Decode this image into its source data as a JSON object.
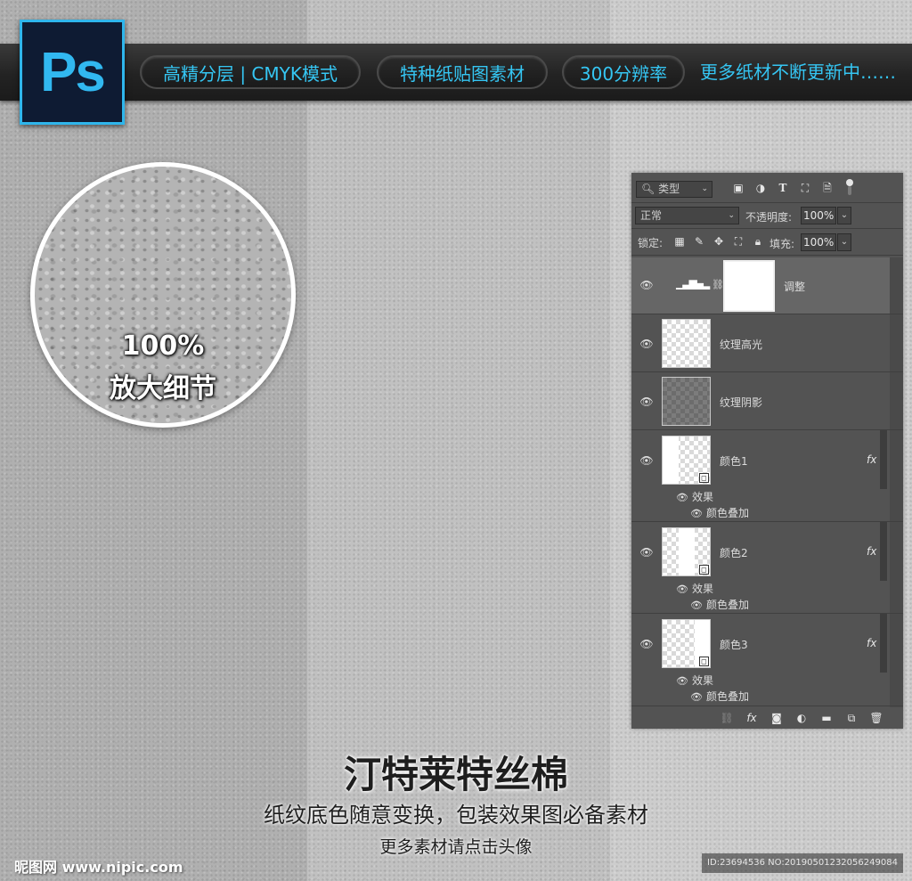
{
  "banner": {
    "logo_text": "Ps",
    "pills": [
      "高精分层 | CMYK模式",
      "特种纸贴图素材",
      "300分辨率"
    ],
    "more_text": "更多纸材不断更新中……"
  },
  "magnifier": {
    "percent": "100%",
    "label": "放大细节"
  },
  "layers_panel": {
    "filter": {
      "kind_label": "类型",
      "icons": [
        "image-filter-icon",
        "adjustment-filter-icon",
        "type-filter-icon",
        "shape-filter-icon",
        "smart-object-filter-icon"
      ]
    },
    "blend_mode": "正常",
    "opacity_label": "不透明度:",
    "opacity_value": "100%",
    "lock_label": "锁定:",
    "fill_label": "填充:",
    "fill_value": "100%",
    "layers": [
      {
        "name": "调整",
        "type": "adjustment",
        "selected": true
      },
      {
        "name": "纹理高光",
        "type": "transparent"
      },
      {
        "name": "纹理阴影",
        "type": "dark"
      },
      {
        "name": "颜色1",
        "type": "color",
        "fx": "fx",
        "effects_label": "效果",
        "effect": "颜色叠加"
      },
      {
        "name": "颜色2",
        "type": "color",
        "fx": "fx",
        "effects_label": "效果",
        "effect": "颜色叠加"
      },
      {
        "name": "颜色3",
        "type": "color",
        "fx": "fx",
        "effects_label": "效果",
        "effect": "颜色叠加"
      }
    ]
  },
  "footer": {
    "title": "汀特莱特丝棉",
    "subtitle": "纸纹底色随意变换，包装效果图必备素材",
    "subtitle2": "更多素材请点击头像",
    "watermark": "昵图网 www.nipic.com",
    "id_text": "ID:23694536 NO:20190501232056249084"
  }
}
